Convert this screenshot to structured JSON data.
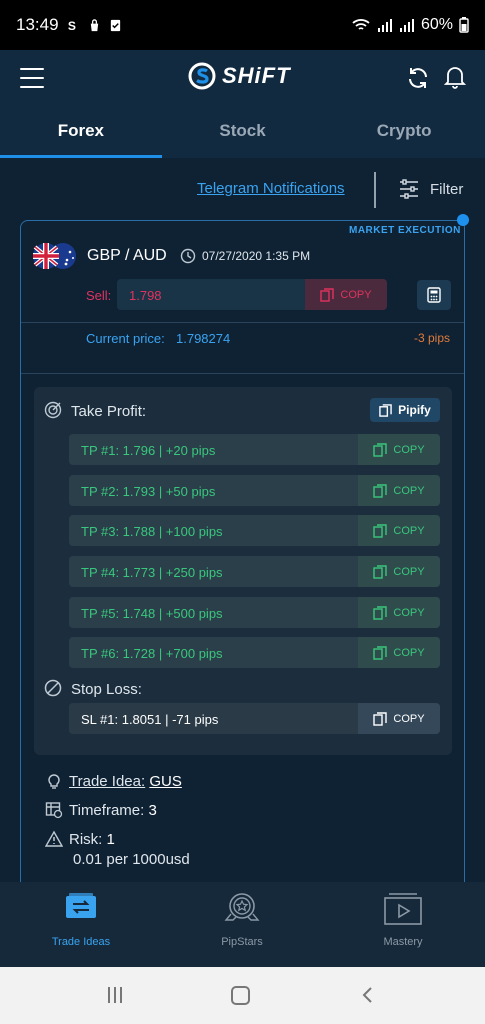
{
  "status_bar": {
    "time": "13:49",
    "battery": "60%"
  },
  "app": {
    "brand": "SHiFT"
  },
  "tabs": [
    {
      "label": "Forex",
      "active": true
    },
    {
      "label": "Stock",
      "active": false
    },
    {
      "label": "Crypto",
      "active": false
    }
  ],
  "filter_row": {
    "telegram_link": "Telegram Notifications",
    "filter_label": "Filter"
  },
  "signal": {
    "execution_type": "MARKET EXECUTION",
    "pair": "GBP / AUD",
    "datetime": "07/27/2020 1:35 PM",
    "sell_label": "Sell:",
    "sell_value": "1.798",
    "copy_label": "COPY",
    "current_price_label": "Current price:",
    "current_price": "1.798274",
    "pips": "-3 pips"
  },
  "take_profit": {
    "title": "Take Profit:",
    "pipify_label": "Pipify",
    "rows": [
      {
        "text": "TP #1: 1.796 | +20 pips",
        "copy": "COPY"
      },
      {
        "text": "TP #2: 1.793 | +50 pips",
        "copy": "COPY"
      },
      {
        "text": "TP #3: 1.788 | +100 pips",
        "copy": "COPY"
      },
      {
        "text": "TP #4: 1.773 | +250 pips",
        "copy": "COPY"
      },
      {
        "text": "TP #5: 1.748 | +500 pips",
        "copy": "COPY"
      },
      {
        "text": "TP #6: 1.728 | +700 pips",
        "copy": "COPY"
      }
    ]
  },
  "stop_loss": {
    "title": "Stop Loss:",
    "row": {
      "text": "SL #1: 1.8051 | -71 pips",
      "copy": "COPY"
    }
  },
  "details": {
    "trade_idea_label": "Trade Idea:",
    "trade_idea_value": "GUS",
    "timeframe_label": "Timeframe:",
    "timeframe_value": "3",
    "risk_label": "Risk:",
    "risk_value": "1",
    "risk_note": "0.01 per 1000usd"
  },
  "bottom_nav": [
    {
      "label": "Trade Ideas",
      "icon": "trade-ideas-icon",
      "active": true
    },
    {
      "label": "PipStars",
      "icon": "pipstars-icon",
      "active": false
    },
    {
      "label": "Mastery",
      "icon": "mastery-icon",
      "active": false
    }
  ],
  "colors": {
    "accent": "#1e90e8",
    "sell": "#e0335e",
    "profit": "#39c77d",
    "loss_pips": "#e07a3a",
    "background": "#0f2234"
  }
}
